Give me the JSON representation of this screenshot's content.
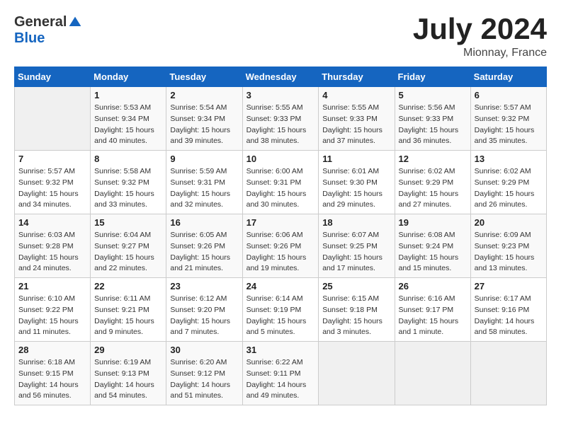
{
  "header": {
    "logo_general": "General",
    "logo_blue": "Blue",
    "month": "July 2024",
    "location": "Mionnay, France"
  },
  "days_of_week": [
    "Sunday",
    "Monday",
    "Tuesday",
    "Wednesday",
    "Thursday",
    "Friday",
    "Saturday"
  ],
  "weeks": [
    [
      {
        "day": "",
        "info": ""
      },
      {
        "day": "1",
        "info": "Sunrise: 5:53 AM\nSunset: 9:34 PM\nDaylight: 15 hours\nand 40 minutes."
      },
      {
        "day": "2",
        "info": "Sunrise: 5:54 AM\nSunset: 9:34 PM\nDaylight: 15 hours\nand 39 minutes."
      },
      {
        "day": "3",
        "info": "Sunrise: 5:55 AM\nSunset: 9:33 PM\nDaylight: 15 hours\nand 38 minutes."
      },
      {
        "day": "4",
        "info": "Sunrise: 5:55 AM\nSunset: 9:33 PM\nDaylight: 15 hours\nand 37 minutes."
      },
      {
        "day": "5",
        "info": "Sunrise: 5:56 AM\nSunset: 9:33 PM\nDaylight: 15 hours\nand 36 minutes."
      },
      {
        "day": "6",
        "info": "Sunrise: 5:57 AM\nSunset: 9:32 PM\nDaylight: 15 hours\nand 35 minutes."
      }
    ],
    [
      {
        "day": "7",
        "info": "Sunrise: 5:57 AM\nSunset: 9:32 PM\nDaylight: 15 hours\nand 34 minutes."
      },
      {
        "day": "8",
        "info": "Sunrise: 5:58 AM\nSunset: 9:32 PM\nDaylight: 15 hours\nand 33 minutes."
      },
      {
        "day": "9",
        "info": "Sunrise: 5:59 AM\nSunset: 9:31 PM\nDaylight: 15 hours\nand 32 minutes."
      },
      {
        "day": "10",
        "info": "Sunrise: 6:00 AM\nSunset: 9:31 PM\nDaylight: 15 hours\nand 30 minutes."
      },
      {
        "day": "11",
        "info": "Sunrise: 6:01 AM\nSunset: 9:30 PM\nDaylight: 15 hours\nand 29 minutes."
      },
      {
        "day": "12",
        "info": "Sunrise: 6:02 AM\nSunset: 9:29 PM\nDaylight: 15 hours\nand 27 minutes."
      },
      {
        "day": "13",
        "info": "Sunrise: 6:02 AM\nSunset: 9:29 PM\nDaylight: 15 hours\nand 26 minutes."
      }
    ],
    [
      {
        "day": "14",
        "info": "Sunrise: 6:03 AM\nSunset: 9:28 PM\nDaylight: 15 hours\nand 24 minutes."
      },
      {
        "day": "15",
        "info": "Sunrise: 6:04 AM\nSunset: 9:27 PM\nDaylight: 15 hours\nand 22 minutes."
      },
      {
        "day": "16",
        "info": "Sunrise: 6:05 AM\nSunset: 9:26 PM\nDaylight: 15 hours\nand 21 minutes."
      },
      {
        "day": "17",
        "info": "Sunrise: 6:06 AM\nSunset: 9:26 PM\nDaylight: 15 hours\nand 19 minutes."
      },
      {
        "day": "18",
        "info": "Sunrise: 6:07 AM\nSunset: 9:25 PM\nDaylight: 15 hours\nand 17 minutes."
      },
      {
        "day": "19",
        "info": "Sunrise: 6:08 AM\nSunset: 9:24 PM\nDaylight: 15 hours\nand 15 minutes."
      },
      {
        "day": "20",
        "info": "Sunrise: 6:09 AM\nSunset: 9:23 PM\nDaylight: 15 hours\nand 13 minutes."
      }
    ],
    [
      {
        "day": "21",
        "info": "Sunrise: 6:10 AM\nSunset: 9:22 PM\nDaylight: 15 hours\nand 11 minutes."
      },
      {
        "day": "22",
        "info": "Sunrise: 6:11 AM\nSunset: 9:21 PM\nDaylight: 15 hours\nand 9 minutes."
      },
      {
        "day": "23",
        "info": "Sunrise: 6:12 AM\nSunset: 9:20 PM\nDaylight: 15 hours\nand 7 minutes."
      },
      {
        "day": "24",
        "info": "Sunrise: 6:14 AM\nSunset: 9:19 PM\nDaylight: 15 hours\nand 5 minutes."
      },
      {
        "day": "25",
        "info": "Sunrise: 6:15 AM\nSunset: 9:18 PM\nDaylight: 15 hours\nand 3 minutes."
      },
      {
        "day": "26",
        "info": "Sunrise: 6:16 AM\nSunset: 9:17 PM\nDaylight: 15 hours\nand 1 minute."
      },
      {
        "day": "27",
        "info": "Sunrise: 6:17 AM\nSunset: 9:16 PM\nDaylight: 14 hours\nand 58 minutes."
      }
    ],
    [
      {
        "day": "28",
        "info": "Sunrise: 6:18 AM\nSunset: 9:15 PM\nDaylight: 14 hours\nand 56 minutes."
      },
      {
        "day": "29",
        "info": "Sunrise: 6:19 AM\nSunset: 9:13 PM\nDaylight: 14 hours\nand 54 minutes."
      },
      {
        "day": "30",
        "info": "Sunrise: 6:20 AM\nSunset: 9:12 PM\nDaylight: 14 hours\nand 51 minutes."
      },
      {
        "day": "31",
        "info": "Sunrise: 6:22 AM\nSunset: 9:11 PM\nDaylight: 14 hours\nand 49 minutes."
      },
      {
        "day": "",
        "info": ""
      },
      {
        "day": "",
        "info": ""
      },
      {
        "day": "",
        "info": ""
      }
    ]
  ]
}
